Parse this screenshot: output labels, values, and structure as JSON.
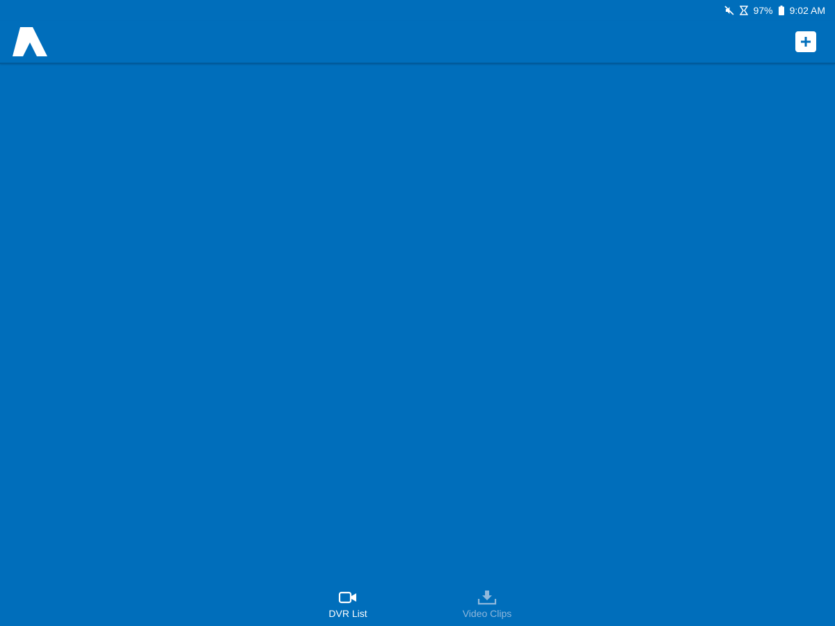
{
  "status_bar": {
    "icons": [
      "mute-icon",
      "alarm-icon",
      "battery-icon"
    ],
    "battery": "97%",
    "time": "9:02 AM"
  },
  "app_bar": {
    "logo": "app-logo",
    "add_icon": "plus-icon"
  },
  "bottom_nav": {
    "items": [
      {
        "label": "DVR List",
        "icon": "video-camera-icon",
        "active": true
      },
      {
        "label": "Video Clips",
        "icon": "download-icon",
        "active": false
      }
    ]
  },
  "colors": {
    "background": "#006ebb",
    "active": "#ffffff",
    "inactive": "#8fb8dc"
  }
}
